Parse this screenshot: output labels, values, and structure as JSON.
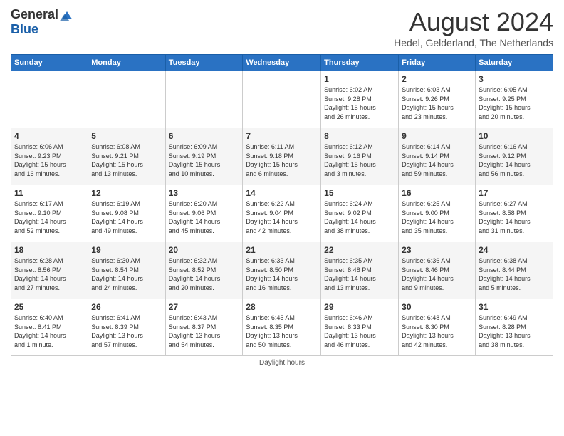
{
  "header": {
    "logo_general": "General",
    "logo_blue": "Blue",
    "month_title": "August 2024",
    "subtitle": "Hedel, Gelderland, The Netherlands"
  },
  "weekdays": [
    "Sunday",
    "Monday",
    "Tuesday",
    "Wednesday",
    "Thursday",
    "Friday",
    "Saturday"
  ],
  "weeks": [
    [
      {
        "day": "",
        "info": ""
      },
      {
        "day": "",
        "info": ""
      },
      {
        "day": "",
        "info": ""
      },
      {
        "day": "",
        "info": ""
      },
      {
        "day": "1",
        "info": "Sunrise: 6:02 AM\nSunset: 9:28 PM\nDaylight: 15 hours\nand 26 minutes."
      },
      {
        "day": "2",
        "info": "Sunrise: 6:03 AM\nSunset: 9:26 PM\nDaylight: 15 hours\nand 23 minutes."
      },
      {
        "day": "3",
        "info": "Sunrise: 6:05 AM\nSunset: 9:25 PM\nDaylight: 15 hours\nand 20 minutes."
      }
    ],
    [
      {
        "day": "4",
        "info": "Sunrise: 6:06 AM\nSunset: 9:23 PM\nDaylight: 15 hours\nand 16 minutes."
      },
      {
        "day": "5",
        "info": "Sunrise: 6:08 AM\nSunset: 9:21 PM\nDaylight: 15 hours\nand 13 minutes."
      },
      {
        "day": "6",
        "info": "Sunrise: 6:09 AM\nSunset: 9:19 PM\nDaylight: 15 hours\nand 10 minutes."
      },
      {
        "day": "7",
        "info": "Sunrise: 6:11 AM\nSunset: 9:18 PM\nDaylight: 15 hours\nand 6 minutes."
      },
      {
        "day": "8",
        "info": "Sunrise: 6:12 AM\nSunset: 9:16 PM\nDaylight: 15 hours\nand 3 minutes."
      },
      {
        "day": "9",
        "info": "Sunrise: 6:14 AM\nSunset: 9:14 PM\nDaylight: 14 hours\nand 59 minutes."
      },
      {
        "day": "10",
        "info": "Sunrise: 6:16 AM\nSunset: 9:12 PM\nDaylight: 14 hours\nand 56 minutes."
      }
    ],
    [
      {
        "day": "11",
        "info": "Sunrise: 6:17 AM\nSunset: 9:10 PM\nDaylight: 14 hours\nand 52 minutes."
      },
      {
        "day": "12",
        "info": "Sunrise: 6:19 AM\nSunset: 9:08 PM\nDaylight: 14 hours\nand 49 minutes."
      },
      {
        "day": "13",
        "info": "Sunrise: 6:20 AM\nSunset: 9:06 PM\nDaylight: 14 hours\nand 45 minutes."
      },
      {
        "day": "14",
        "info": "Sunrise: 6:22 AM\nSunset: 9:04 PM\nDaylight: 14 hours\nand 42 minutes."
      },
      {
        "day": "15",
        "info": "Sunrise: 6:24 AM\nSunset: 9:02 PM\nDaylight: 14 hours\nand 38 minutes."
      },
      {
        "day": "16",
        "info": "Sunrise: 6:25 AM\nSunset: 9:00 PM\nDaylight: 14 hours\nand 35 minutes."
      },
      {
        "day": "17",
        "info": "Sunrise: 6:27 AM\nSunset: 8:58 PM\nDaylight: 14 hours\nand 31 minutes."
      }
    ],
    [
      {
        "day": "18",
        "info": "Sunrise: 6:28 AM\nSunset: 8:56 PM\nDaylight: 14 hours\nand 27 minutes."
      },
      {
        "day": "19",
        "info": "Sunrise: 6:30 AM\nSunset: 8:54 PM\nDaylight: 14 hours\nand 24 minutes."
      },
      {
        "day": "20",
        "info": "Sunrise: 6:32 AM\nSunset: 8:52 PM\nDaylight: 14 hours\nand 20 minutes."
      },
      {
        "day": "21",
        "info": "Sunrise: 6:33 AM\nSunset: 8:50 PM\nDaylight: 14 hours\nand 16 minutes."
      },
      {
        "day": "22",
        "info": "Sunrise: 6:35 AM\nSunset: 8:48 PM\nDaylight: 14 hours\nand 13 minutes."
      },
      {
        "day": "23",
        "info": "Sunrise: 6:36 AM\nSunset: 8:46 PM\nDaylight: 14 hours\nand 9 minutes."
      },
      {
        "day": "24",
        "info": "Sunrise: 6:38 AM\nSunset: 8:44 PM\nDaylight: 14 hours\nand 5 minutes."
      }
    ],
    [
      {
        "day": "25",
        "info": "Sunrise: 6:40 AM\nSunset: 8:41 PM\nDaylight: 14 hours\nand 1 minute."
      },
      {
        "day": "26",
        "info": "Sunrise: 6:41 AM\nSunset: 8:39 PM\nDaylight: 13 hours\nand 57 minutes."
      },
      {
        "day": "27",
        "info": "Sunrise: 6:43 AM\nSunset: 8:37 PM\nDaylight: 13 hours\nand 54 minutes."
      },
      {
        "day": "28",
        "info": "Sunrise: 6:45 AM\nSunset: 8:35 PM\nDaylight: 13 hours\nand 50 minutes."
      },
      {
        "day": "29",
        "info": "Sunrise: 6:46 AM\nSunset: 8:33 PM\nDaylight: 13 hours\nand 46 minutes."
      },
      {
        "day": "30",
        "info": "Sunrise: 6:48 AM\nSunset: 8:30 PM\nDaylight: 13 hours\nand 42 minutes."
      },
      {
        "day": "31",
        "info": "Sunrise: 6:49 AM\nSunset: 8:28 PM\nDaylight: 13 hours\nand 38 minutes."
      }
    ]
  ],
  "footer": {
    "daylight_label": "Daylight hours"
  }
}
